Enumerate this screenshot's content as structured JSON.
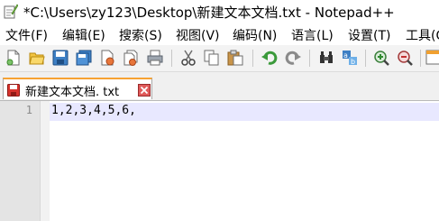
{
  "window": {
    "title": "*C:\\Users\\zy123\\Desktop\\新建文本文档.txt - Notepad++"
  },
  "menu": {
    "items": [
      "文件(F)",
      "编辑(E)",
      "搜索(S)",
      "视图(V)",
      "编码(N)",
      "语言(L)",
      "设置(T)",
      "工具(O"
    ]
  },
  "toolbar": {
    "icons": [
      "new-file-icon",
      "open-file-icon",
      "save-icon",
      "save-all-icon",
      "close-icon",
      "close-all-icon",
      "print-icon",
      "cut-icon",
      "copy-icon",
      "paste-icon",
      "undo-icon",
      "redo-icon",
      "find-icon",
      "replace-icon",
      "zoom-in-icon",
      "zoom-out-icon",
      "sync-scroll-icon"
    ]
  },
  "tabs": [
    {
      "label": "新建文本文档. txt",
      "modified": true
    }
  ],
  "editor": {
    "lines": [
      {
        "number": "1",
        "text": "1,2,3,4,5,6,"
      }
    ]
  },
  "colors": {
    "tab_accent": "#f7a233",
    "current_line": "#e8e8ff",
    "gutter": "#e4e4e4",
    "toolbar_bg": "#f3f3f3"
  }
}
